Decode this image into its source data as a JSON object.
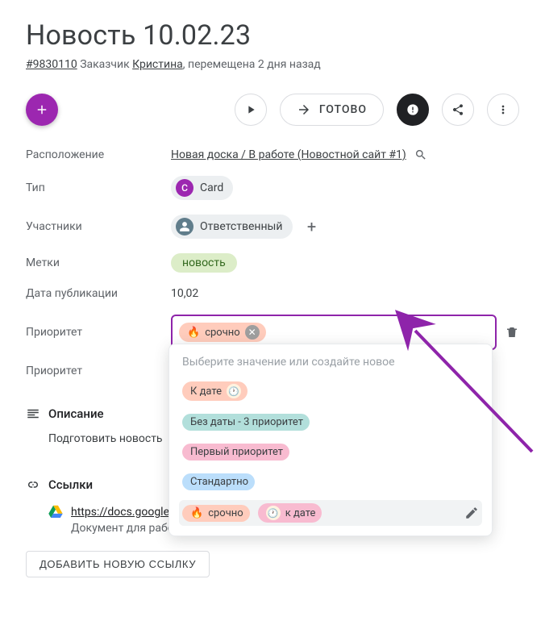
{
  "title": "Новость 10.02.23",
  "meta": {
    "id": "#9830110",
    "customer_label": "Заказчик",
    "customer_name": "Кристина",
    "moved": ", перемещена 2 дня назад"
  },
  "actions": {
    "done": "ГОТОВО"
  },
  "fields": {
    "location": {
      "label": "Расположение",
      "value": "Новая доска / В работе (Новостной сайт #1)"
    },
    "type": {
      "label": "Тип",
      "chip_letter": "C",
      "chip_label": "Card"
    },
    "members": {
      "label": "Участники",
      "chip_label": "Ответственный"
    },
    "tags": {
      "label": "Метки",
      "tag": "новость"
    },
    "pubdate": {
      "label": "Дата публикации",
      "value": "10,02"
    },
    "priority_edit": {
      "label": "Приоритет",
      "selected_tag": "срочно",
      "selected_emoji": "🔥"
    },
    "priority_ro": {
      "label": "Приоритет"
    }
  },
  "dropdown": {
    "hint": "Выберите значение или создайте новое",
    "options": [
      {
        "label": "К дате",
        "color": "peach",
        "icon": "clock"
      },
      {
        "label": "Без даты - 3 приоритет",
        "color": "teal"
      },
      {
        "label": "Первый приоритет",
        "color": "pink"
      },
      {
        "label": "Стандартно",
        "color": "blue"
      },
      {
        "label": "срочно",
        "color": "peach",
        "emoji": "🔥",
        "selected": true,
        "second_label": "к дате",
        "second_icon": "clock",
        "second_color": "pink"
      }
    ]
  },
  "description": {
    "heading": "Описание",
    "text": "Подготовить новость"
  },
  "links": {
    "heading": "Ссылки",
    "items": [
      {
        "url_text": "https://docs.google.c",
        "caption": "Документ для работ"
      }
    ],
    "add_btn": "ДОБАВИТЬ НОВУЮ ССЫЛКУ"
  }
}
